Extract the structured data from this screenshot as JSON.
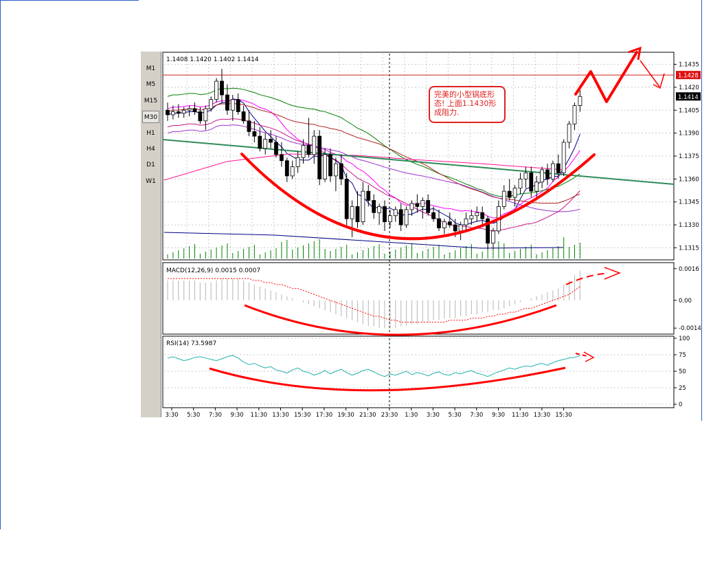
{
  "timeframes": [
    "M1",
    "M5",
    "M15",
    "M30",
    "H1",
    "H4",
    "D1",
    "W1"
  ],
  "selected_timeframe": "M30",
  "colors": {
    "bull": "#ffffff",
    "bear": "#000000",
    "resistance": "#d02020",
    "annotation": "#ff0000",
    "trendline": "#2e8b57",
    "macd_hist": "#c0c0c0",
    "macd_signal": "#ff0000",
    "rsi": "#20b2aa",
    "volume": "#008000",
    "current_price_bg": "#000000",
    "resistance_label_bg": "#e01010"
  },
  "chart_data": [
    {
      "type": "candlestick",
      "ohlc_header": "1.1408 1.1420 1.1402 1.1414",
      "title": "",
      "ylim": [
        1.1308,
        1.1442
      ],
      "y_ticks": [
        "1.1435",
        "1.1420",
        "1.1405",
        "1.1390",
        "1.1375",
        "1.1360",
        "1.1345",
        "1.1330",
        "1.1315"
      ],
      "x_ticks": [
        "3:30",
        "5:30",
        "7:30",
        "9:30",
        "11:30",
        "13:30",
        "15:30",
        "17:30",
        "19:30",
        "21:30",
        "23:30",
        "1:30",
        "3:30",
        "5:30",
        "7:30",
        "9:30",
        "11:30",
        "13:30",
        "15:30"
      ],
      "resistance_price": "1.1428",
      "current_price": "1.1414",
      "annotation_text": [
        "完美的小型锅底形",
        "态! 上面1.1430形",
        "成阻力."
      ],
      "candles": [
        [
          1.1405,
          1.141,
          1.1398,
          1.1402
        ],
        [
          1.1402,
          1.1408,
          1.1399,
          1.1404
        ],
        [
          1.1404,
          1.1409,
          1.14,
          1.1403
        ],
        [
          1.1403,
          1.1407,
          1.14,
          1.1405
        ],
        [
          1.1405,
          1.1408,
          1.1401,
          1.1406
        ],
        [
          1.1406,
          1.141,
          1.1402,
          1.1404
        ],
        [
          1.1404,
          1.1407,
          1.1396,
          1.1398
        ],
        [
          1.1398,
          1.1408,
          1.1392,
          1.1406
        ],
        [
          1.1406,
          1.1414,
          1.1404,
          1.1412
        ],
        [
          1.1412,
          1.1426,
          1.141,
          1.1424
        ],
        [
          1.1424,
          1.1432,
          1.141,
          1.1415
        ],
        [
          1.1415,
          1.1422,
          1.1402,
          1.1405
        ],
        [
          1.1405,
          1.1415,
          1.1398,
          1.1412
        ],
        [
          1.1412,
          1.1416,
          1.1402,
          1.1404
        ],
        [
          1.1404,
          1.1408,
          1.1396,
          1.1398
        ],
        [
          1.1398,
          1.1405,
          1.1388,
          1.1391
        ],
        [
          1.1391,
          1.1398,
          1.1384,
          1.1388
        ],
        [
          1.1388,
          1.1394,
          1.1378,
          1.138
        ],
        [
          1.138,
          1.139,
          1.1376,
          1.1386
        ],
        [
          1.1386,
          1.1392,
          1.138,
          1.1384
        ],
        [
          1.1384,
          1.1388,
          1.1374,
          1.1376
        ],
        [
          1.1376,
          1.1384,
          1.1368,
          1.1372
        ],
        [
          1.1372,
          1.1374,
          1.1358,
          1.1362
        ],
        [
          1.1362,
          1.1372,
          1.136,
          1.1368
        ],
        [
          1.1368,
          1.1378,
          1.1364,
          1.1374
        ],
        [
          1.1374,
          1.1386,
          1.137,
          1.1382
        ],
        [
          1.1382,
          1.14,
          1.1374,
          1.1376
        ],
        [
          1.1376,
          1.1392,
          1.137,
          1.1388
        ],
        [
          1.1388,
          1.1392,
          1.1356,
          1.136
        ],
        [
          1.136,
          1.138,
          1.1358,
          1.1376
        ],
        [
          1.1376,
          1.138,
          1.1358,
          1.1362
        ],
        [
          1.1362,
          1.1374,
          1.1352,
          1.137
        ],
        [
          1.137,
          1.1376,
          1.1356,
          1.136
        ],
        [
          1.136,
          1.1364,
          1.133,
          1.1334
        ],
        [
          1.1334,
          1.1346,
          1.1322,
          1.1342
        ],
        [
          1.1342,
          1.1352,
          1.1328,
          1.1332
        ],
        [
          1.1332,
          1.1358,
          1.133,
          1.1352
        ],
        [
          1.1352,
          1.1356,
          1.1342,
          1.1346
        ],
        [
          1.1346,
          1.135,
          1.1334,
          1.1338
        ],
        [
          1.1338,
          1.1344,
          1.133,
          1.1342
        ],
        [
          1.1342,
          1.1346,
          1.1326,
          1.1332
        ],
        [
          1.1332,
          1.134,
          1.1328,
          1.1336
        ],
        [
          1.1336,
          1.1342,
          1.1332,
          1.134
        ],
        [
          1.134,
          1.1344,
          1.1326,
          1.133
        ],
        [
          1.133,
          1.1342,
          1.1328,
          1.134
        ],
        [
          1.134,
          1.1346,
          1.1336,
          1.1344
        ],
        [
          1.1344,
          1.135,
          1.1338,
          1.1342
        ],
        [
          1.1342,
          1.1348,
          1.1334,
          1.1346
        ],
        [
          1.1346,
          1.135,
          1.1336,
          1.1338
        ],
        [
          1.1338,
          1.1342,
          1.1332,
          1.1334
        ],
        [
          1.1334,
          1.134,
          1.1326,
          1.1328
        ],
        [
          1.1328,
          1.1334,
          1.1324,
          1.1332
        ],
        [
          1.1332,
          1.1338,
          1.1328,
          1.133
        ],
        [
          1.133,
          1.1334,
          1.1322,
          1.1326
        ],
        [
          1.1326,
          1.1332,
          1.132,
          1.133
        ],
        [
          1.133,
          1.1338,
          1.1326,
          1.1334
        ],
        [
          1.1334,
          1.134,
          1.133,
          1.1336
        ],
        [
          1.1336,
          1.1342,
          1.1332,
          1.1338
        ],
        [
          1.1338,
          1.1342,
          1.133,
          1.1334
        ],
        [
          1.1334,
          1.1336,
          1.1314,
          1.1318
        ],
        [
          1.1318,
          1.1328,
          1.1314,
          1.1326
        ],
        [
          1.1326,
          1.1346,
          1.1324,
          1.1342
        ],
        [
          1.1342,
          1.1356,
          1.134,
          1.1352
        ],
        [
          1.1352,
          1.136,
          1.1346,
          1.1348
        ],
        [
          1.1348,
          1.1356,
          1.1342,
          1.1354
        ],
        [
          1.1354,
          1.1364,
          1.135,
          1.136
        ],
        [
          1.136,
          1.1368,
          1.1354,
          1.1364
        ],
        [
          1.1364,
          1.1368,
          1.1348,
          1.1352
        ],
        [
          1.1352,
          1.1362,
          1.1346,
          1.1358
        ],
        [
          1.1358,
          1.1368,
          1.1354,
          1.1366
        ],
        [
          1.1366,
          1.137,
          1.1356,
          1.136
        ],
        [
          1.136,
          1.1372,
          1.1358,
          1.137
        ],
        [
          1.137,
          1.1376,
          1.136,
          1.1364
        ],
        [
          1.1364,
          1.1386,
          1.1362,
          1.1384
        ],
        [
          1.1384,
          1.1398,
          1.138,
          1.1396
        ],
        [
          1.1396,
          1.141,
          1.1392,
          1.1408
        ],
        [
          1.1408,
          1.1418,
          1.1404,
          1.1414
        ]
      ]
    },
    {
      "type": "bar",
      "label": "MACD(12,26,9)  0.0015  0.0007",
      "y_ticks": [
        "0.0016",
        "0.00",
        "-0.0014"
      ],
      "ylim": [
        -0.0016,
        0.0018
      ],
      "histogram": [
        0.001,
        0.001,
        0.001,
        0.001,
        0.001,
        0.001,
        0.0009,
        0.0009,
        0.0009,
        0.001,
        0.0011,
        0.0011,
        0.0011,
        0.0011,
        0.001,
        0.0009,
        0.0008,
        0.0007,
        0.0006,
        0.0005,
        0.0004,
        0.0003,
        0.0002,
        0.0001,
        0.0,
        -0.0001,
        -0.0002,
        -0.0003,
        -0.0004,
        -0.0005,
        -0.0006,
        -0.0007,
        -0.0008,
        -0.0009,
        -0.001,
        -0.0011,
        -0.0012,
        -0.0013,
        -0.0013,
        -0.0014,
        -0.0014,
        -0.0014,
        -0.0014,
        -0.0013,
        -0.0013,
        -0.0012,
        -0.0012,
        -0.0011,
        -0.0011,
        -0.001,
        -0.001,
        -0.0009,
        -0.0009,
        -0.0009,
        -0.0008,
        -0.0008,
        -0.0007,
        -0.0007,
        -0.0006,
        -0.0006,
        -0.0005,
        -0.0005,
        -0.0004,
        -0.0003,
        -0.0002,
        -0.0001,
        0.0,
        0.0001,
        0.0002,
        0.0003,
        0.0004,
        0.0005,
        0.0006,
        0.0008,
        0.001,
        0.0013,
        0.0015
      ],
      "signal": [
        0.0011,
        0.0011,
        0.0011,
        0.0011,
        0.0011,
        0.0011,
        0.0011,
        0.0011,
        0.0011,
        0.0011,
        0.0011,
        0.0011,
        0.0011,
        0.0011,
        0.0011,
        0.0011,
        0.001,
        0.001,
        0.0009,
        0.0009,
        0.0008,
        0.0008,
        0.0007,
        0.0006,
        0.0006,
        0.0005,
        0.0004,
        0.0003,
        0.0002,
        0.0001,
        0.0,
        -0.0001,
        -0.0002,
        -0.0003,
        -0.0004,
        -0.0005,
        -0.0006,
        -0.0007,
        -0.0008,
        -0.0008,
        -0.0009,
        -0.001,
        -0.001,
        -0.0011,
        -0.0011,
        -0.0011,
        -0.0011,
        -0.0011,
        -0.0011,
        -0.0011,
        -0.0011,
        -0.0011,
        -0.001,
        -0.001,
        -0.001,
        -0.001,
        -0.0009,
        -0.0009,
        -0.0009,
        -0.0008,
        -0.0008,
        -0.0007,
        -0.0007,
        -0.0006,
        -0.0006,
        -0.0005,
        -0.0004,
        -0.0004,
        -0.0003,
        -0.0002,
        -0.0001,
        0.0,
        0.0001,
        0.0002,
        0.0003,
        0.0005,
        0.0007
      ]
    },
    {
      "type": "line",
      "label": "RSI(14)  73.5987",
      "y_ticks": [
        "100",
        "75",
        "50",
        "25",
        "0"
      ],
      "ylim": [
        0,
        100
      ],
      "values": [
        70,
        72,
        69,
        66,
        68,
        71,
        72,
        70,
        68,
        66,
        69,
        72,
        74,
        70,
        64,
        60,
        62,
        58,
        55,
        57,
        52,
        50,
        47,
        52,
        55,
        50,
        48,
        44,
        47,
        51,
        46,
        50,
        53,
        48,
        44,
        47,
        51,
        53,
        49,
        45,
        42,
        46,
        44,
        47,
        50,
        45,
        48,
        46,
        43,
        47,
        49,
        45,
        44,
        48,
        46,
        49,
        51,
        47,
        45,
        42,
        46,
        49,
        52,
        55,
        53,
        56,
        58,
        57,
        60,
        62,
        59,
        63,
        66,
        68,
        70,
        71,
        73.6
      ]
    }
  ]
}
